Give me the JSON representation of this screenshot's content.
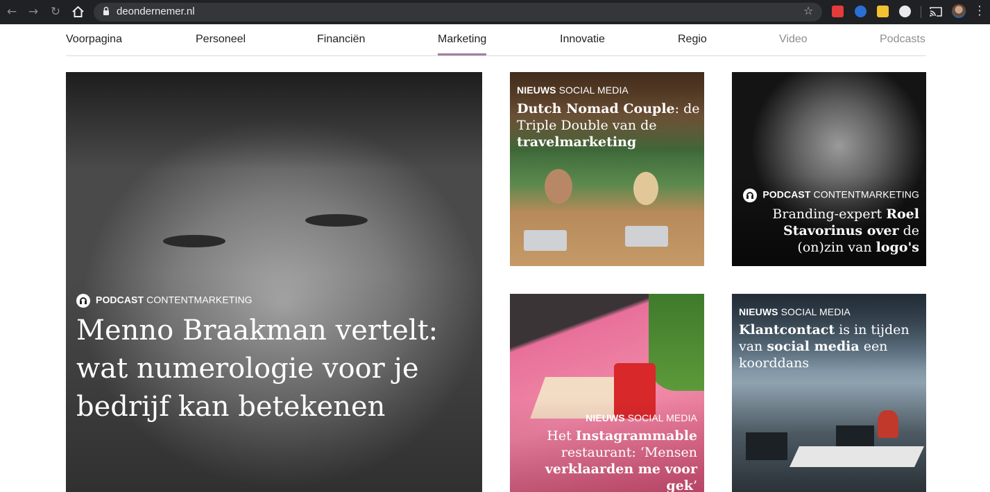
{
  "browser": {
    "url": "deondernemer.nl"
  },
  "nav": {
    "items": [
      {
        "label": "Voorpagina"
      },
      {
        "label": "Personeel"
      },
      {
        "label": "Financiën"
      },
      {
        "label": "Marketing"
      },
      {
        "label": "Innovatie"
      },
      {
        "label": "Regio"
      },
      {
        "label": "Video"
      },
      {
        "label": "Podcasts"
      }
    ],
    "active": "Marketing",
    "accent_color": "#a67c9f"
  },
  "articles": [
    {
      "type": "PODCAST",
      "category": "CONTENTMARKETING",
      "title_bold_1": "Menno Braakman",
      "title_plain_1": " vertelt: wat ",
      "title_bold_2": "numerologie",
      "title_plain_2": " voor je bedrijf kan betekenen"
    },
    {
      "type": "NIEUWS",
      "category": "SOCIAL MEDIA",
      "title_bold_1": "Dutch Nomad Couple",
      "title_plain_1": ": de Triple Double van de ",
      "title_bold_2": "travelmarketing"
    },
    {
      "type": "PODCAST",
      "category": "CONTENTMARKETING",
      "title_plain_1": "Branding-expert ",
      "title_bold_1": "Roel Stavorinus over",
      "title_plain_2": " de (on)zin van ",
      "title_bold_2": "logo's"
    },
    {
      "type": "NIEUWS",
      "category": "SOCIAL MEDIA",
      "title_plain_1": "Het ",
      "title_bold_1": "Instagrammable",
      "title_plain_2": " restaurant: ‘Mensen ",
      "title_bold_2": "verklaarden me voor gek",
      "title_plain_3": "’"
    },
    {
      "type": "NIEUWS",
      "category": "SOCIAL MEDIA",
      "title_bold_1": "Klantcontact",
      "title_plain_1": " is in tijden van ",
      "title_bold_2": "social media",
      "title_plain_2": " een koorddans"
    }
  ]
}
